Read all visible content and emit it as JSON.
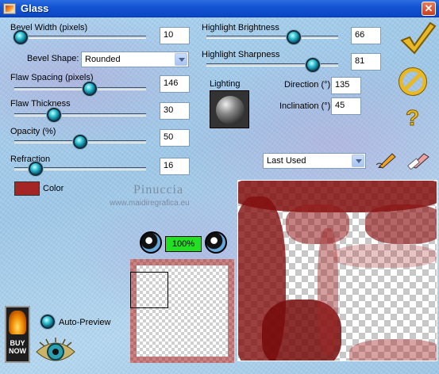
{
  "window": {
    "title": "Glass"
  },
  "controls": {
    "bevel_width": {
      "label": "Bevel Width (pixels)",
      "value": "10",
      "level": 0.05
    },
    "bevel_shape": {
      "label": "Bevel Shape:",
      "value": "Rounded"
    },
    "flaw_spacing": {
      "label": "Flaw Spacing (pixels)",
      "value": "146",
      "level": 0.57
    },
    "flaw_thickness": {
      "label": "Flaw Thickness",
      "value": "30",
      "level": 0.3
    },
    "opacity": {
      "label": "Opacity (%)",
      "value": "50",
      "level": 0.5
    },
    "refraction": {
      "label": "Refraction",
      "value": "16",
      "level": 0.16
    },
    "color": {
      "label": "Color",
      "hex": "#a52424"
    },
    "highlight_brightness": {
      "label": "Highlight Brightness",
      "value": "66",
      "level": 0.66
    },
    "highlight_sharpness": {
      "label": "Highlight Sharpness",
      "value": "81",
      "level": 0.81
    },
    "lighting": {
      "label": "Lighting"
    },
    "direction": {
      "label": "Direction (°)",
      "value": "135"
    },
    "inclination": {
      "label": "Inclination (°)",
      "value": "45"
    },
    "presets": {
      "value": "Last Used"
    }
  },
  "preview": {
    "zoom": "100%"
  },
  "auto_preview": {
    "label": "Auto-Preview"
  },
  "buy_now": {
    "label": "BUY NOW"
  },
  "icons": [
    "checkmark-icon",
    "cancel-icon",
    "help-icon",
    "save-preset-icon",
    "delete-preset-icon",
    "zoom-out-icon",
    "zoom-in-icon",
    "eye-icon"
  ],
  "watermark": {
    "name": "Pinuccia",
    "url": "www.maidiregrafica.eu"
  }
}
